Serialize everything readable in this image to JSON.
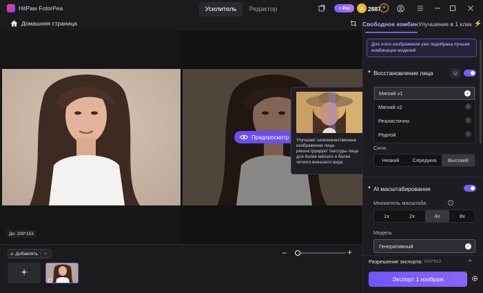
{
  "app": {
    "name": "HitPaw FotorPea",
    "credits": "2887",
    "pro_label": "+ Pro"
  },
  "tabs": [
    {
      "label": "Усилитель"
    },
    {
      "label": "Редактор"
    }
  ],
  "breadcrumb": {
    "home": "Домашняя страница"
  },
  "canvas": {
    "before_size": "До: 200*153",
    "preview_button": "Предпросмотр"
  },
  "tooltip": {
    "text": "Улучшает низкокачественные изображения лица-реконструирует текстуры лица для более мягкого и более четкого внешнего вида."
  },
  "bottom": {
    "add_label": "Добавлять",
    "zoom_level": 0.05
  },
  "panel": {
    "tabs": [
      {
        "label": "Свободное комбинирование"
      },
      {
        "label": "Улучшение в 1 клик"
      }
    ],
    "notice": "Для этого изображения уже подобрана лучшая комбинация моделей",
    "face": {
      "title": "Восстановление лица",
      "enabled": true,
      "models": [
        {
          "label": "Мягкий v1",
          "selected": true
        },
        {
          "label": "Мягкий v2",
          "selected": false
        },
        {
          "label": "Реалистично",
          "selected": false
        },
        {
          "label": "Родной",
          "selected": false
        }
      ],
      "strength_label": "Сила",
      "strength_options": [
        "Низкий",
        "Середина",
        "Высокий"
      ],
      "strength_selected": "Высокий"
    },
    "upscale": {
      "title": "AI масштабирование",
      "enabled": true,
      "multiplier_label": "Множитель масштаба",
      "multipliers": [
        "1x",
        "2x",
        "4x",
        "8x"
      ],
      "multiplier_selected": "4x",
      "model_label": "Модель",
      "model_value": "Генеративный"
    },
    "export": {
      "resolution_label": "Разрешение экспорта:",
      "resolution_value": "800*612",
      "button": "Экспорт 1 изображ"
    }
  },
  "colors": {
    "accent": "#7b5cff",
    "coin": "#f0b43a"
  }
}
